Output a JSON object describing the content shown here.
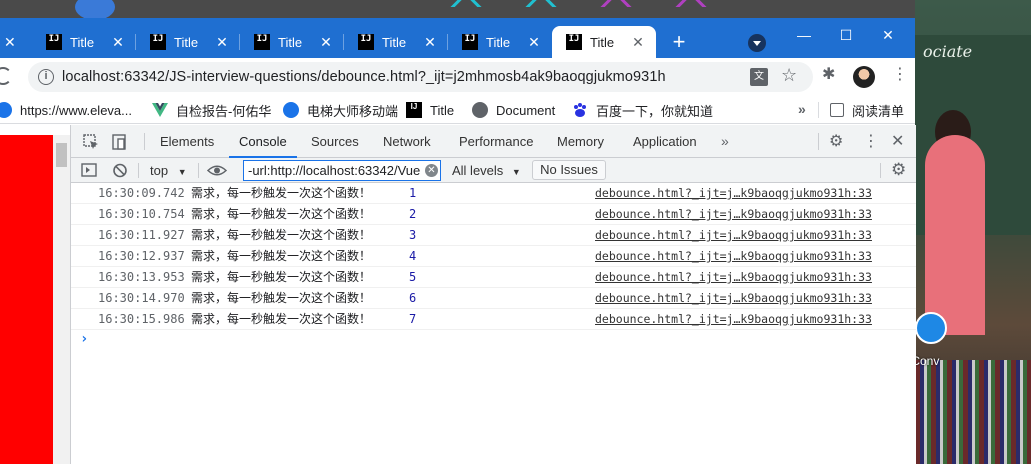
{
  "tabs": [
    {
      "label": "Title"
    },
    {
      "label": "Title"
    },
    {
      "label": "Title"
    },
    {
      "label": "Title"
    },
    {
      "label": "Title"
    },
    {
      "label": "Title",
      "active": true
    }
  ],
  "tab_fav_text": "IJ",
  "address": {
    "url": "localhost:63342/JS-interview-questions/debounce.html?_ijt=j2mhmosb4ak9baoqgjukmo931h"
  },
  "bookmarks": [
    {
      "label": "https://www.eleva...",
      "icon": "globe-icon"
    },
    {
      "label": "自检报告-何佑华",
      "icon": "vue-icon"
    },
    {
      "label": "电梯大师移动端",
      "icon": "globe-icon"
    },
    {
      "label": "Title",
      "icon": "intellij-icon"
    },
    {
      "label": "Document",
      "icon": "globe-icon"
    },
    {
      "label": "百度一下，你就知道",
      "icon": "baidu-icon"
    }
  ],
  "reading_list": "阅读清单",
  "devtools": {
    "tabs": [
      "Elements",
      "Console",
      "Sources",
      "Network",
      "Performance",
      "Memory",
      "Application"
    ],
    "active_tab": "Console",
    "context": "top",
    "filter_value": "-url:http://localhost:63342/Vue",
    "levels": "All levels",
    "issues": "No Issues"
  },
  "console_logs": [
    {
      "time": "16:30:09.742",
      "message": "需求，每一秒触发一次这个函数！",
      "value": "1",
      "source": "debounce.html?_ijt=j…k9baoqgjukmo931h:33"
    },
    {
      "time": "16:30:10.754",
      "message": "需求，每一秒触发一次这个函数！",
      "value": "2",
      "source": "debounce.html?_ijt=j…k9baoqgjukmo931h:33"
    },
    {
      "time": "16:30:11.927",
      "message": "需求，每一秒触发一次这个函数！",
      "value": "3",
      "source": "debounce.html?_ijt=j…k9baoqgjukmo931h:33"
    },
    {
      "time": "16:30:12.937",
      "message": "需求，每一秒触发一次这个函数！",
      "value": "4",
      "source": "debounce.html?_ijt=j…k9baoqgjukmo931h:33"
    },
    {
      "time": "16:30:13.953",
      "message": "需求，每一秒触发一次这个函数！",
      "value": "5",
      "source": "debounce.html?_ijt=j…k9baoqgjukmo931h:33"
    },
    {
      "time": "16:30:14.970",
      "message": "需求，每一秒触发一次这个函数！",
      "value": "6",
      "source": "debounce.html?_ijt=j…k9baoqgjukmo931h:33"
    },
    {
      "time": "16:30:15.986",
      "message": "需求，每一秒触发一次这个函数！",
      "value": "7",
      "source": "debounce.html?_ijt=j…k9baoqgjukmo931h:33"
    }
  ],
  "desktop": {
    "icon_label": "tConv"
  },
  "colors": {
    "tabstrip": "#1f6fd1",
    "devtools_accent": "#1a73e8",
    "page_red": "#ff0000"
  }
}
